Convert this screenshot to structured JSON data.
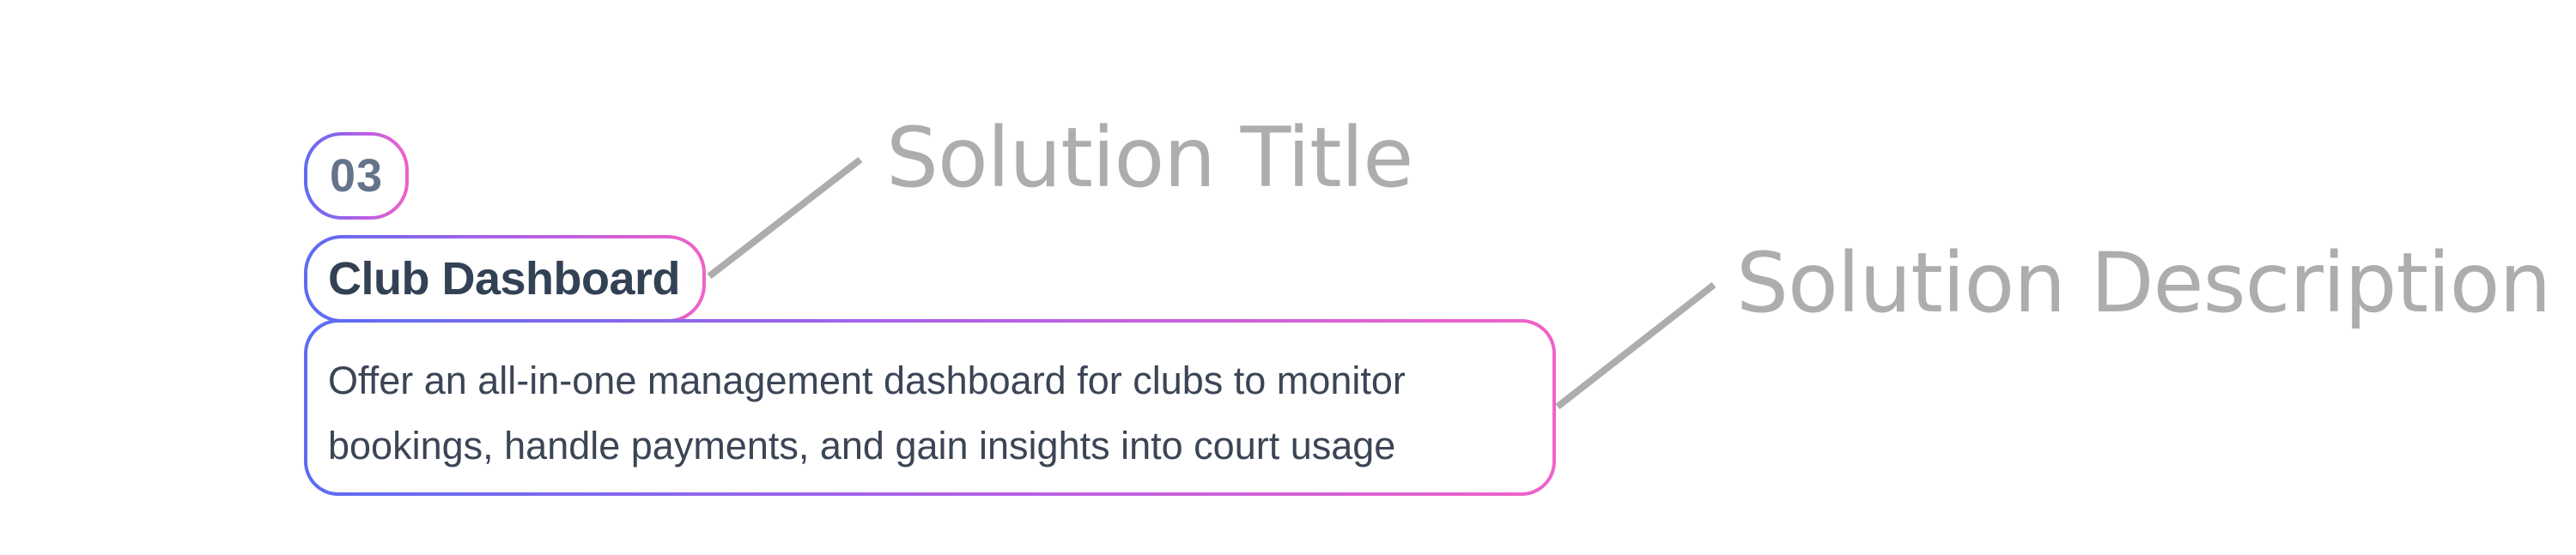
{
  "card": {
    "number": "03",
    "title": "Club Dashboard",
    "description": "Offer an all-in-one management dashboard for clubs to monitor bookings, handle payments, and gain insights into court usage"
  },
  "annotations": {
    "title_label": "Solution Title",
    "description_label": "Solution Description"
  },
  "colors": {
    "gradient_start": "#5b6cf2",
    "gradient_mid": "#b460e6",
    "gradient_end": "#f062c8",
    "annotation": "#adadad",
    "number": "#64748b",
    "title": "#334155",
    "body_text": "#3b4556"
  }
}
